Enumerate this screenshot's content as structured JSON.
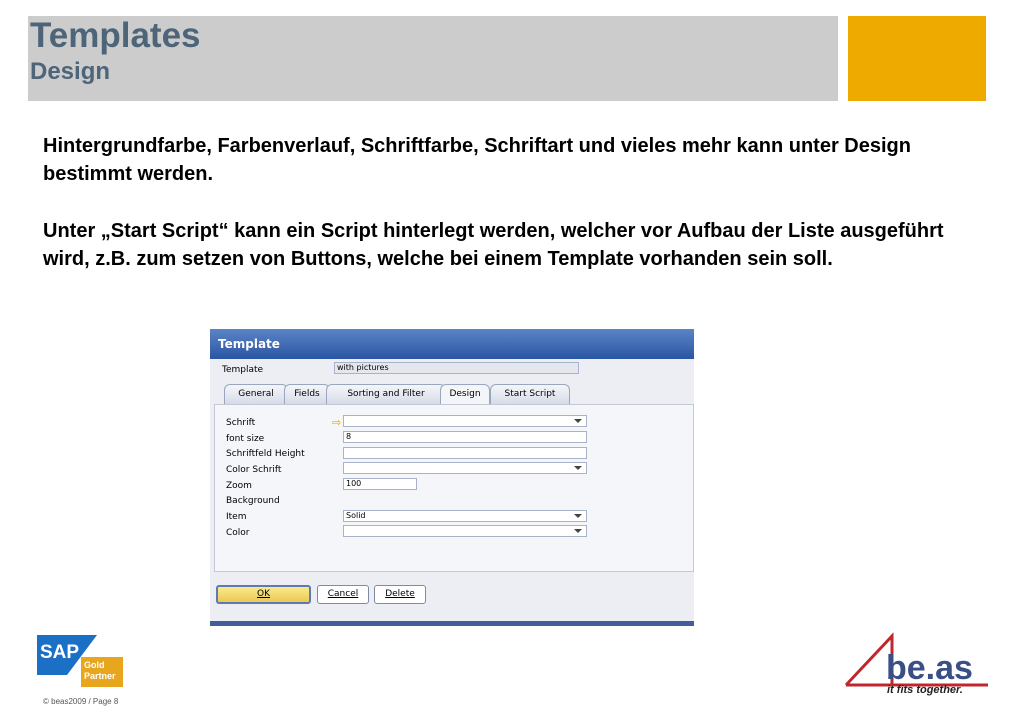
{
  "header": {
    "title": "Templates",
    "subtitle": "Design",
    "accent_color": "#efaa00",
    "title_color": "#4d6479"
  },
  "body": {
    "paragraph1": "Hintergrundfarbe, Farbenverlauf, Schriftfarbe, Schriftart und vieles mehr kann unter Design bestimmt werden.",
    "paragraph2": "Unter „Start Script“ kann ein Script hinterlegt werden, welcher vor Aufbau der Liste ausgeführt wird, z.B. zum setzen von Buttons, welche bei einem Template vorhanden sein soll."
  },
  "dialog": {
    "title": "Template",
    "template_label": "Template",
    "template_value": "with pictures",
    "tabs": [
      "General",
      "Fields",
      "Sorting and Filter",
      "Design",
      "Start Script"
    ],
    "active_tab": "Design",
    "fields": {
      "schrift": {
        "label": "Schrift",
        "value": ""
      },
      "font_size": {
        "label": "font size",
        "value": "8"
      },
      "schriftfeld_height": {
        "label": "Schriftfeld Height",
        "value": ""
      },
      "color_schrift": {
        "label": "Color Schrift",
        "value": ""
      },
      "zoom": {
        "label": "Zoom",
        "value": "100"
      },
      "background": {
        "label": "Background"
      },
      "item": {
        "label": "Item",
        "value": "Solid"
      },
      "color": {
        "label": "Color",
        "value": ""
      }
    },
    "buttons": {
      "ok": "OK",
      "cancel": "Cancel",
      "delete": "Delete"
    }
  },
  "footer": {
    "sap_logo_text": "SAP",
    "sap_badge": "Gold Partner",
    "copyright": "© beas2009 / Page 8",
    "beas_logo_text": "be.as",
    "beas_tagline": "it fits together."
  }
}
